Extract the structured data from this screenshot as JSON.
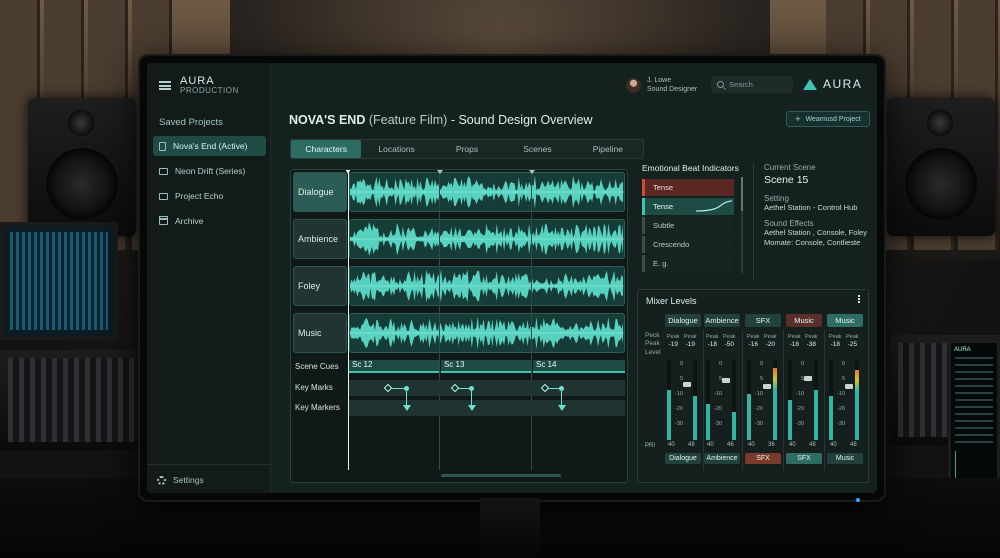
{
  "app": {
    "brand_name": "AURA",
    "brand_sub": "PRODUCTION",
    "logo_text": "AURA",
    "accent": "#3ec4b2"
  },
  "user": {
    "name": "J. Lowe",
    "role": "Sound Designer"
  },
  "search": {
    "placeholder": "Search"
  },
  "sidebar": {
    "section_title": "Saved Projects",
    "projects": [
      {
        "label": "Nova's End (Active)",
        "icon": "file-icon"
      },
      {
        "label": "Neon Drift (Series)",
        "icon": "folder-icon"
      },
      {
        "label": "Project Echo",
        "icon": "folder-icon"
      },
      {
        "label": "Archive",
        "icon": "archive-icon"
      }
    ],
    "settings_label": "Settings"
  },
  "page": {
    "title_strong": "NOVA'S END",
    "title_paren": "(Feature Film)",
    "title_rest": "- Sound Design Overview",
    "new_project_label": "Weamusd Project"
  },
  "tabs": [
    "Characters",
    "Locations",
    "Props",
    "Scenes",
    "Pipeline"
  ],
  "tracks": [
    {
      "label": "Dialogue"
    },
    {
      "label": "Ambience"
    },
    {
      "label": "Foley"
    },
    {
      "label": "Music"
    }
  ],
  "cues": {
    "header": "Scene Cues",
    "scenes": [
      "Sc 12",
      "Sc 13",
      "Sc 14"
    ],
    "rows": [
      "Key Marks",
      "Key Markers"
    ]
  },
  "emotional": {
    "title": "Emotional Beat Indicators",
    "items": [
      "Tense",
      "Tense",
      "Subtle",
      "Crescendo",
      "E. g."
    ]
  },
  "scene": {
    "label": "Current Scene",
    "value": "Scene 15",
    "setting_label": "Setting",
    "setting_value": "Aethel Station - Control Hub",
    "effects_label": "Sound Effects",
    "effects_value": "Aethel Station , Console, Foley Momate: Console, Contlieste"
  },
  "mixer": {
    "title": "Mixer Levels",
    "left_labels": [
      "Peck",
      "Peak",
      "Level"
    ],
    "pr_label": "PRI",
    "scale": [
      "0",
      "5",
      "-10",
      "-20",
      "-30"
    ],
    "channels": [
      {
        "name": "Dialogue",
        "peak_a": "-19",
        "peak_b": "-19",
        "foot_a": "40",
        "foot_b": "48",
        "btn": "Dialogue",
        "btn_color": "default",
        "head_color": "default",
        "level": 0.62,
        "level_b": 0.55,
        "fader": 0.72
      },
      {
        "name": "Ambience",
        "peak_a": "-18",
        "peak_b": "-50",
        "foot_a": "40",
        "foot_b": "46",
        "btn": "Ambience",
        "btn_color": "default",
        "head_color": "default",
        "level": 0.45,
        "level_b": 0.35,
        "fader": 0.78
      },
      {
        "name": "SFX",
        "peak_a": "-16",
        "peak_b": "-20",
        "foot_a": "40",
        "foot_b": "36",
        "btn": "SFX",
        "btn_color": "red",
        "head_color": "default",
        "level": 0.58,
        "level_b": 0.9,
        "fader": 0.7
      },
      {
        "name": "Music",
        "peak_a": "-18",
        "peak_b": "-38",
        "foot_a": "40",
        "foot_b": "48",
        "btn": "SFX",
        "btn_color": "teal",
        "head_color": "red",
        "level": 0.5,
        "level_b": 0.62,
        "fader": 0.8
      },
      {
        "name": "Music",
        "peak_a": "-18",
        "peak_b": "-25",
        "foot_a": "40",
        "foot_b": "48",
        "btn": "Music",
        "btn_color": "default",
        "head_color": "teal",
        "level": 0.55,
        "level_b": 0.88,
        "fader": 0.7
      }
    ]
  }
}
